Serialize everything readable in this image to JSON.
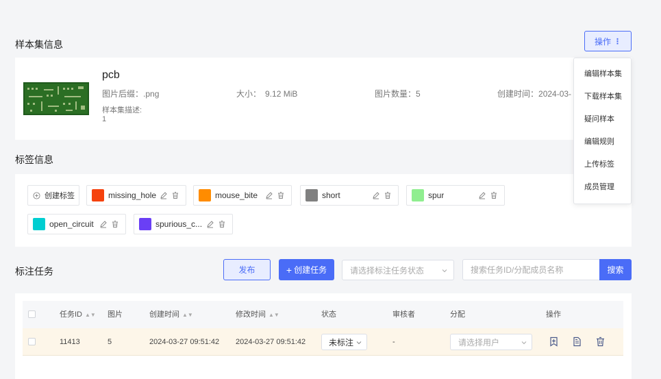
{
  "dataset": {
    "section_title": "样本集信息",
    "ops_button": "操作",
    "name": "pcb",
    "suffix_label": "图片后缀：",
    "suffix_value": ".png",
    "size_label": "大小：",
    "size_value": "9.12 MiB",
    "count_label": "图片数量：",
    "count_value": "5",
    "created_label": "创建时间：",
    "created_value": "2024-03-",
    "desc_label": "样本集描述:",
    "desc_value": "1"
  },
  "ops_menu": {
    "items": [
      "编辑样本集",
      "下载样本集",
      "疑问样本",
      "编辑规则",
      "上传标签",
      "成员管理"
    ]
  },
  "labels": {
    "section_title": "标签信息",
    "create_label": "创建标签",
    "items": [
      {
        "name": "missing_hole",
        "color": "#f5420e"
      },
      {
        "name": "mouse_bite",
        "color": "#ff8c00"
      },
      {
        "name": "short",
        "color": "#808080"
      },
      {
        "name": "spur",
        "color": "#90ee90"
      },
      {
        "name": "open_circuit",
        "color": "#00ced1"
      },
      {
        "name": "spurious_c...",
        "color": "#6a3ff5"
      }
    ]
  },
  "tasks": {
    "section_title": "标注任务",
    "publish_button": "发布",
    "create_button": "创建任务",
    "status_placeholder": "请选择标注任务状态",
    "search_placeholder": "搜索任务ID/分配成员名称",
    "search_button": "搜索",
    "columns": [
      "任务ID",
      "图片",
      "创建时间",
      "修改时间",
      "状态",
      "审核者",
      "分配",
      "操作"
    ],
    "rows": [
      {
        "id": "11413",
        "images": "5",
        "created": "2024-03-27 09:51:42",
        "modified": "2024-03-27 09:51:42",
        "status": "未标注",
        "reviewer": "-",
        "assign_placeholder": "请选择用户"
      }
    ]
  },
  "colors": {
    "accent": "#4a6cf7",
    "row_highlight": "#fdf6e9",
    "background": "#f4f5f7"
  }
}
